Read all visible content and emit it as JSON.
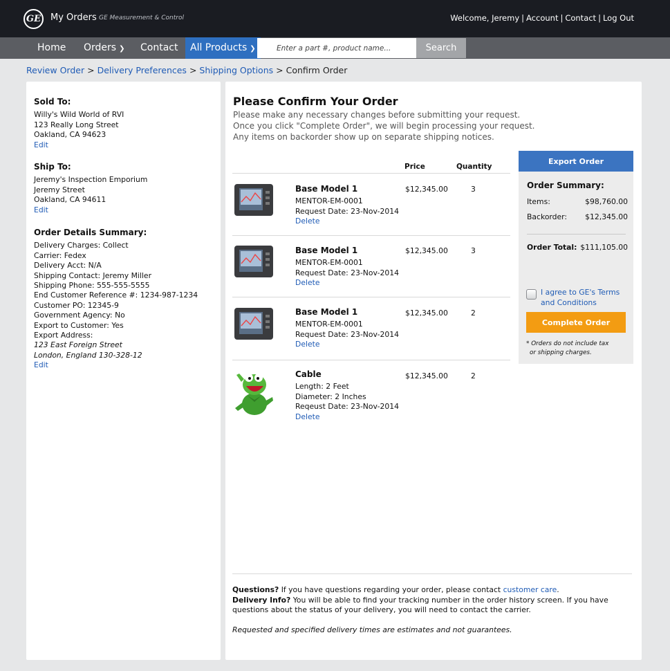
{
  "header": {
    "app_title": "My Orders",
    "app_subtitle": "GE Measurement & Control",
    "welcome": "Welcome, Jeremy",
    "links": [
      "Account",
      "Contact",
      "Log Out"
    ],
    "separator": "|"
  },
  "nav": {
    "items": [
      "Home",
      "Orders",
      "Contact",
      "All Products"
    ],
    "search_placeholder": "Enter a part #, product name...",
    "search_button": "Search"
  },
  "breadcrumb": {
    "links": [
      "Review Order",
      "Delivery Preferences",
      "Shipping Options"
    ],
    "current": "Confirm Order",
    "separator": ">"
  },
  "sold_to": {
    "title": "Sold To:",
    "lines": [
      "Willy's Wild World of RVI",
      "123 Really Long Street",
      "Oakland, CA 94623"
    ],
    "edit": "Edit"
  },
  "ship_to": {
    "title": "Ship To:",
    "lines": [
      "Jeremy's Inspection Emporium",
      "Jeremy Street",
      "Oakland, CA 94611"
    ],
    "edit": "Edit"
  },
  "order_details": {
    "title": "Order Details Summary:",
    "lines": [
      "Delivery Charges: Collect",
      "Carrier: Fedex",
      "Delivery Acct: N/A",
      "Shipping Contact: Jeremy Miller",
      "Shipping Phone: 555-555-5555",
      "End Customer Reference #: 1234-987-1234",
      "Customer PO: 12345-9",
      "Government Agency: No",
      "Export to Customer: Yes",
      "Export Address:"
    ],
    "address_lines": [
      "123 East Foreign Street",
      "London, England 130-328-12"
    ],
    "edit": "Edit"
  },
  "main": {
    "title": "Please Confirm Your Order",
    "intro": [
      "Please make any necessary changes before submitting your request.",
      "Once you click \"Complete Order\", we will begin processing your request.",
      "Any items on backorder show up on separate shipping notices."
    ],
    "columns": {
      "price": "Price",
      "quantity": "Quantity"
    },
    "items": [
      {
        "name": "Base Model 1",
        "meta": [
          "MENTOR-EM-0001",
          "Request Date: 23-Nov-2014"
        ],
        "delete": "Delete",
        "price": "$12,345.00",
        "qty": "3",
        "image": "device"
      },
      {
        "name": "Base Model 1",
        "meta": [
          "MENTOR-EM-0001",
          "Request Date: 23-Nov-2014"
        ],
        "delete": "Delete",
        "price": "$12,345.00",
        "qty": "3",
        "image": "device"
      },
      {
        "name": "Base Model 1",
        "meta": [
          "MENTOR-EM-0001",
          "Request Date: 23-Nov-2014"
        ],
        "delete": "Delete",
        "price": "$12,345.00",
        "qty": "2",
        "image": "device"
      },
      {
        "name": "Cable",
        "meta": [
          "Length: 2 Feet",
          "Diameter: 2 Inches",
          "Reqeust Date: 23-Nov-2014"
        ],
        "delete": "Delete",
        "price": "$12,345.00",
        "qty": "2",
        "image": "frog"
      }
    ]
  },
  "summary": {
    "export_button": "Export Order",
    "title": "Order Summary:",
    "items_label": "Items:",
    "items_value": "$98,760.00",
    "backorder_label": "Backorder:",
    "backorder_value": "$12,345.00",
    "total_label": "Order Total:",
    "total_value": "$111,105.00",
    "agree_lines": [
      "I agree to GE's Terms",
      "and Conditions"
    ],
    "complete_button": "Complete Order",
    "note_lines": [
      "* Orders do not include tax",
      "or shipping charges."
    ]
  },
  "footer": {
    "questions_label": "Questions?",
    "questions_text": " If you have questions regarding your order, please contact ",
    "customer_care": "customer care",
    "period": ".",
    "delivery_label": "Delivery Info?",
    "delivery_text1": " You will be able to find your tracking number in the order history screen. If you have",
    "delivery_text2": "questions about the status of your delivery, you will need to contact the carrier.",
    "disclaimer": "Requested and specified delivery times are estimates and not guarantees."
  },
  "colors": {
    "topbar": "#1a1c22",
    "navbar": "#5b5d62",
    "accent_blue": "#2e6fc0",
    "link": "#1f5bb5",
    "complete_orange": "#f39c12"
  }
}
